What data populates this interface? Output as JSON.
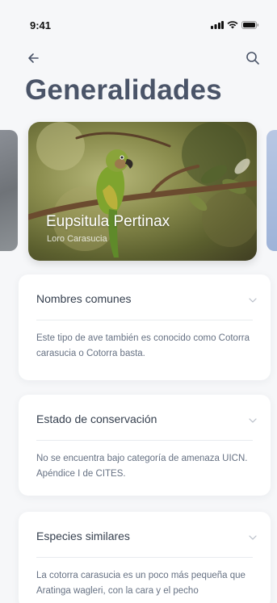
{
  "status_bar": {
    "time": "9:41",
    "icons": [
      "signal-icon",
      "wifi-icon",
      "battery-icon"
    ]
  },
  "nav": {
    "back_icon": "arrow-left-icon",
    "search_icon": "search-icon"
  },
  "page": {
    "title": "Generalidades"
  },
  "featured": {
    "name": "Eupsitula Pertinax",
    "common_name": "Loro Carasucia"
  },
  "sections": [
    {
      "title": "Nombres comunes",
      "body": "Este tipo de ave también es conocido como Cotorra carasucia o Cotorra basta."
    },
    {
      "title": "Estado de conservación",
      "body": "No se encuentra bajo categoría de amenaza UICN. Apéndice I de CITES."
    },
    {
      "title": "Especies similares",
      "body": "La cotorra carasucia es un poco más pequeña que Aratinga wagleri, con la cara y el pecho"
    }
  ],
  "colors": {
    "background": "#f6f7f9",
    "title": "#4a5468",
    "body_text": "#667183"
  }
}
